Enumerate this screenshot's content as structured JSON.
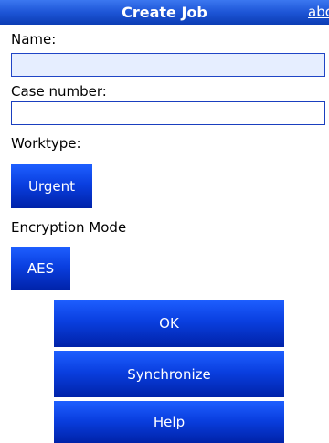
{
  "header": {
    "title": "Create Job",
    "input_mode": "abc"
  },
  "form": {
    "name": {
      "label": "Name:",
      "value": ""
    },
    "case_number": {
      "label": "Case number:",
      "value": ""
    },
    "worktype": {
      "label": "Worktype:",
      "value": "Urgent"
    },
    "encryption": {
      "label": "Encryption Mode",
      "value": "AES"
    }
  },
  "actions": {
    "ok_label": "OK",
    "sync_label": "Synchronize",
    "help_label": "Help"
  },
  "colors": {
    "accent": "#0a3fe0",
    "title_bar": "#1d55d6",
    "field_border": "#1a3fbf",
    "focused_field_bg": "#e6eeff"
  }
}
